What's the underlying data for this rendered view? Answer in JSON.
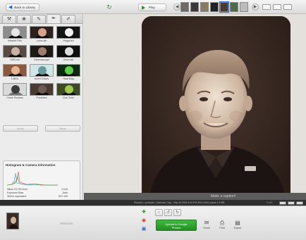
{
  "toolbar": {
    "back_label": "Back to Library",
    "play_label": "Play"
  },
  "tabs": [
    {
      "icon": "wrench-icon",
      "glyph": "⚒"
    },
    {
      "icon": "tuning-icon",
      "glyph": "❀"
    },
    {
      "icon": "brush-icon",
      "glyph": "✎"
    },
    {
      "icon": "brush-active-icon",
      "glyph": "✒"
    },
    {
      "icon": "brush-alt-icon",
      "glyph": "✐"
    }
  ],
  "effects": [
    {
      "label": "Infrared Film",
      "bg": "#8c8c8c",
      "fg": "#e8e8e8"
    },
    {
      "label": "Lomo-ish",
      "bg": "#2b2220",
      "fg": "#d7a28a"
    },
    {
      "label": "Holga-ish",
      "bg": "#151515",
      "fg": "#f2f2f2"
    },
    {
      "label": "HDR-ish",
      "bg": "#5a4a44",
      "fg": "#c7b2a4"
    },
    {
      "label": "Cinemascope",
      "bg": "#1e1a18",
      "fg": "#9c7d6f"
    },
    {
      "label": "Orton-ish",
      "bg": "#0f0f0f",
      "fg": "#dcdcdc"
    },
    {
      "label": "1960's",
      "bg": "#8a5a40",
      "fg": "#e7b38e"
    },
    {
      "label": "Invert Colors",
      "bg": "#cfe6e6",
      "fg": "#6a9aa0"
    },
    {
      "label": "Heat Map",
      "bg": "#0c2a10",
      "fg": "#5ccb4a"
    },
    {
      "label": "Cross Process",
      "bg": "#d9d9d9",
      "fg": "#3b3b3b"
    },
    {
      "label": "Posterize",
      "bg": "#4a3a34",
      "fg": "#6e5a50"
    },
    {
      "label": "Duo-Tone",
      "bg": "#3e4a24",
      "fg": "#9fc94e"
    }
  ],
  "grid_buttons": {
    "left": "Undo",
    "right": "Redo"
  },
  "histogram": {
    "title": "Histogram & Camera Information",
    "rows": [
      {
        "k": "Nikon D3 35.0mm",
        "v": "1/125"
      },
      {
        "k": "Exposure Bias",
        "v": "Auto"
      },
      {
        "k": "35mm equivalent",
        "v": "ISO 100"
      }
    ]
  },
  "caption": {
    "placeholder": "Make a caption!"
  },
  "status": {
    "text": "Pictures > portraits / Unknown Cap... Sep 26 2003 4:03 PM   3021×4044 pixels   1.9 MB",
    "page": "1 of 1"
  },
  "bottom": {
    "tray_label": "Selection",
    "upload_line1": "Upload to Google",
    "upload_line2": "Photos",
    "email_label": "Email",
    "print_label": "Print",
    "export_label": "Export"
  }
}
